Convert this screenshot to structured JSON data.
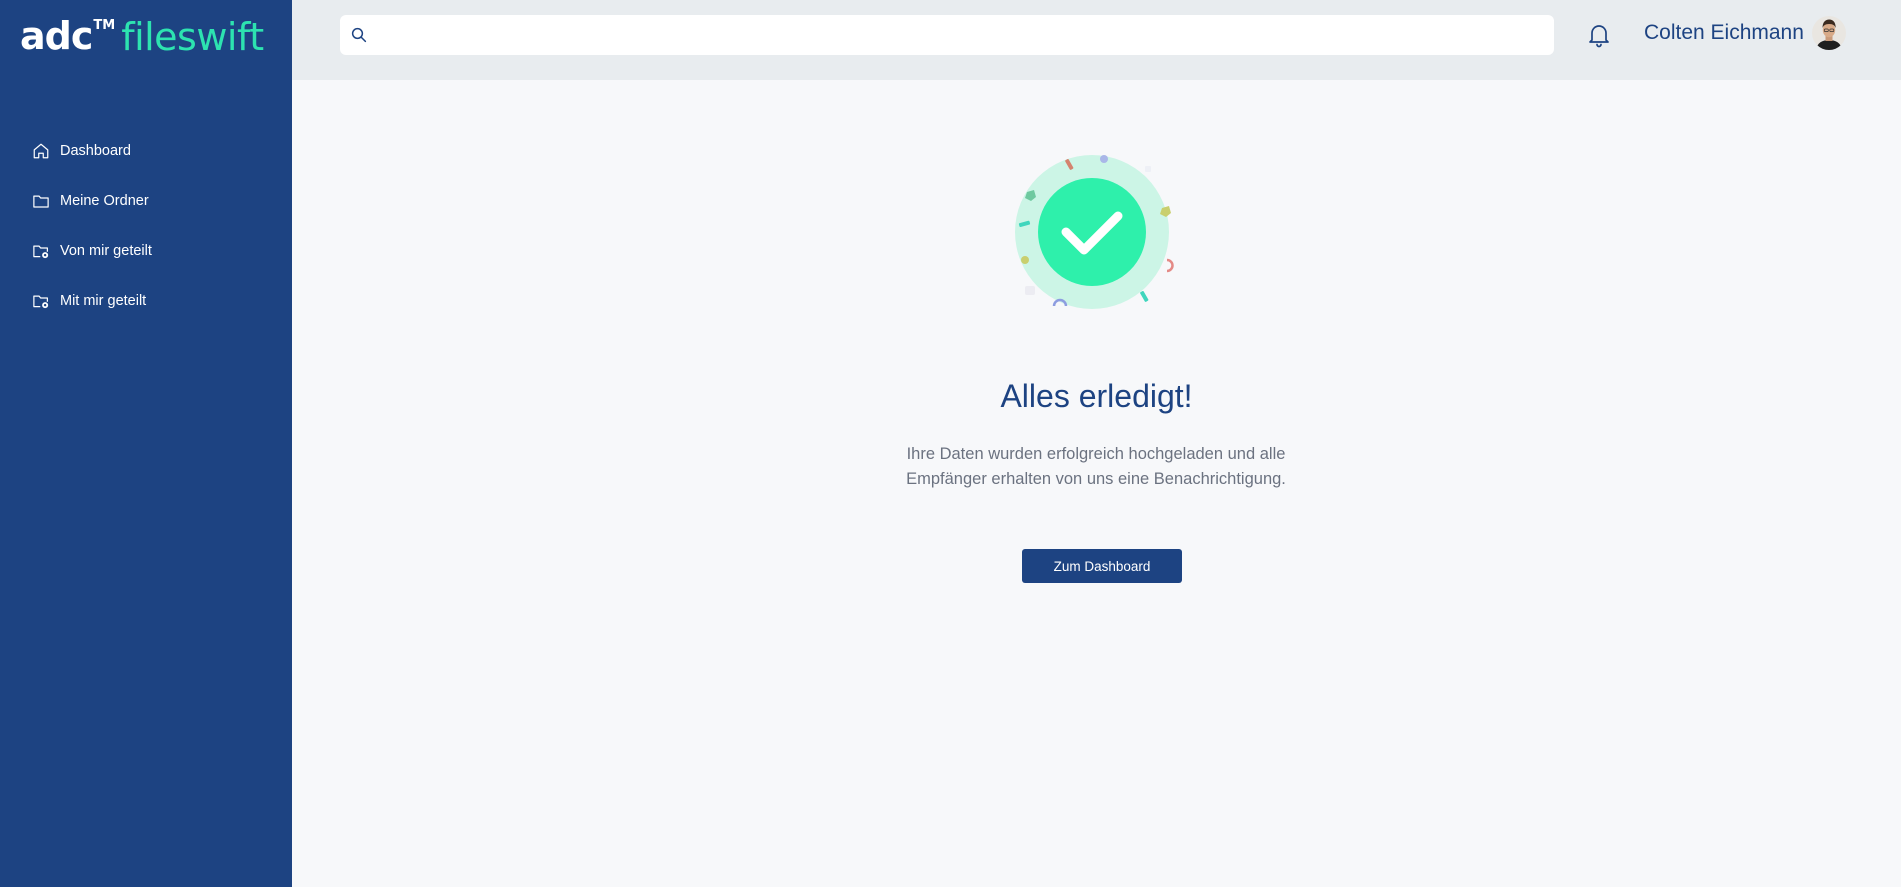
{
  "brand": {
    "adc": "adc",
    "trademark": "TM",
    "product": "fileswift"
  },
  "sidebar": {
    "items": [
      {
        "label": "Dashboard",
        "icon": "home-icon"
      },
      {
        "label": "Meine Ordner",
        "icon": "folder-icon"
      },
      {
        "label": "Von mir geteilt",
        "icon": "folder-share-icon"
      },
      {
        "label": "Mit mir geteilt",
        "icon": "folder-share-icon"
      }
    ]
  },
  "header": {
    "search": {
      "value": "",
      "placeholder": ""
    },
    "user_name": "Colten Eichmann"
  },
  "main": {
    "title": "Alles erledigt!",
    "description": "Ihre Daten wurden erfolgreich hochgeladen und alle Empfänger erhalten von uns eine Benachrichtigung.",
    "button_label": "Zum Dashboard"
  },
  "colors": {
    "sidebar_bg": "#1d4382",
    "brand_accent": "#2de3b0",
    "success": "#2ef0ab",
    "topbar_bg": "#e8ecef"
  }
}
